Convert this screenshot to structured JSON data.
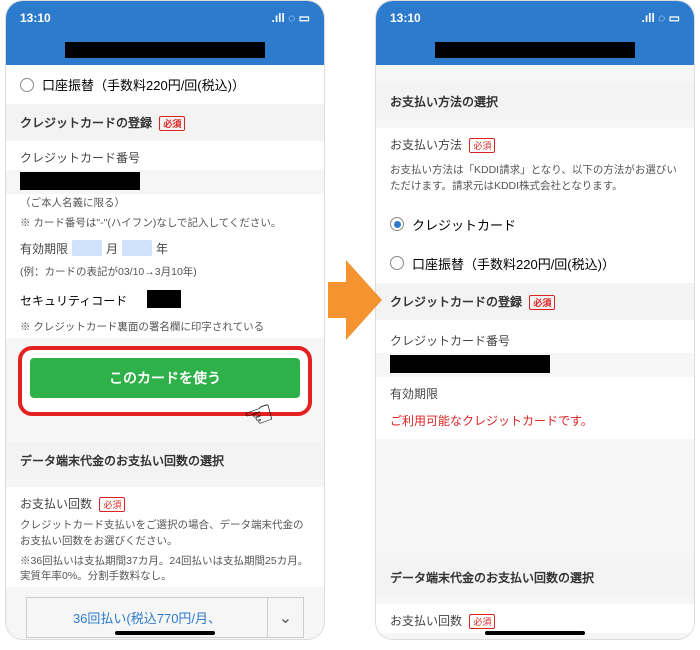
{
  "status": {
    "time": "13:10",
    "signal": "▮▮▮▮",
    "wifi": "�员",
    "battery": "▭"
  },
  "left": {
    "radio_bank": "口座振替（手数料220円/回(税込)）",
    "cc_register": "クレジットカードの登録",
    "required": "必須",
    "cc_number_label": "クレジットカード番号",
    "name_note": "（ご本人名義に限る）",
    "hyphen_note": "※ カード番号は\"-\"(ハイフン)なしで記入してください。",
    "exp_label": "有効期限",
    "month": "月",
    "year": "年",
    "exp_note": "(例：カードの表記が03/10→3月10年)",
    "sec_label": "セキュリティコード",
    "sec_note": "※ クレジットカード裏面の署名欄に印字されている",
    "use_card_btn": "このカードを使う",
    "device_pay_title": "データ端末代金のお支払い回数の選択",
    "pay_count_label": "お支払い回数",
    "pay_note1": "クレジットカード支払いをご選択の場合、データ端末代金のお支払い回数をお選びください。",
    "pay_note2": "※36回払いは支払期間37カ月。24回払いは支払期間25カ月。実質年率0%。分割手数料なし。",
    "dropdown_val": "36回払い(税込770円/月、"
  },
  "right": {
    "pay_method_title": "お支払い方法の選択",
    "pay_method_label": "お支払い方法",
    "required": "必須",
    "info": "お支払い方法は「KDDI請求」となり、以下の方法がお選びいただけます。請求元はKDDI株式会社となります。",
    "radio_cc": "クレジットカード",
    "radio_bank": "口座振替（手数料220円/回(税込)）",
    "cc_register": "クレジットカードの登録",
    "cc_number_label": "クレジットカード番号",
    "exp_label": "有効期限",
    "ok_msg": "ご利用可能なクレジットカードです。",
    "device_pay_title": "データ端末代金のお支払い回数の選択",
    "pay_count_label": "お支払い回数"
  }
}
